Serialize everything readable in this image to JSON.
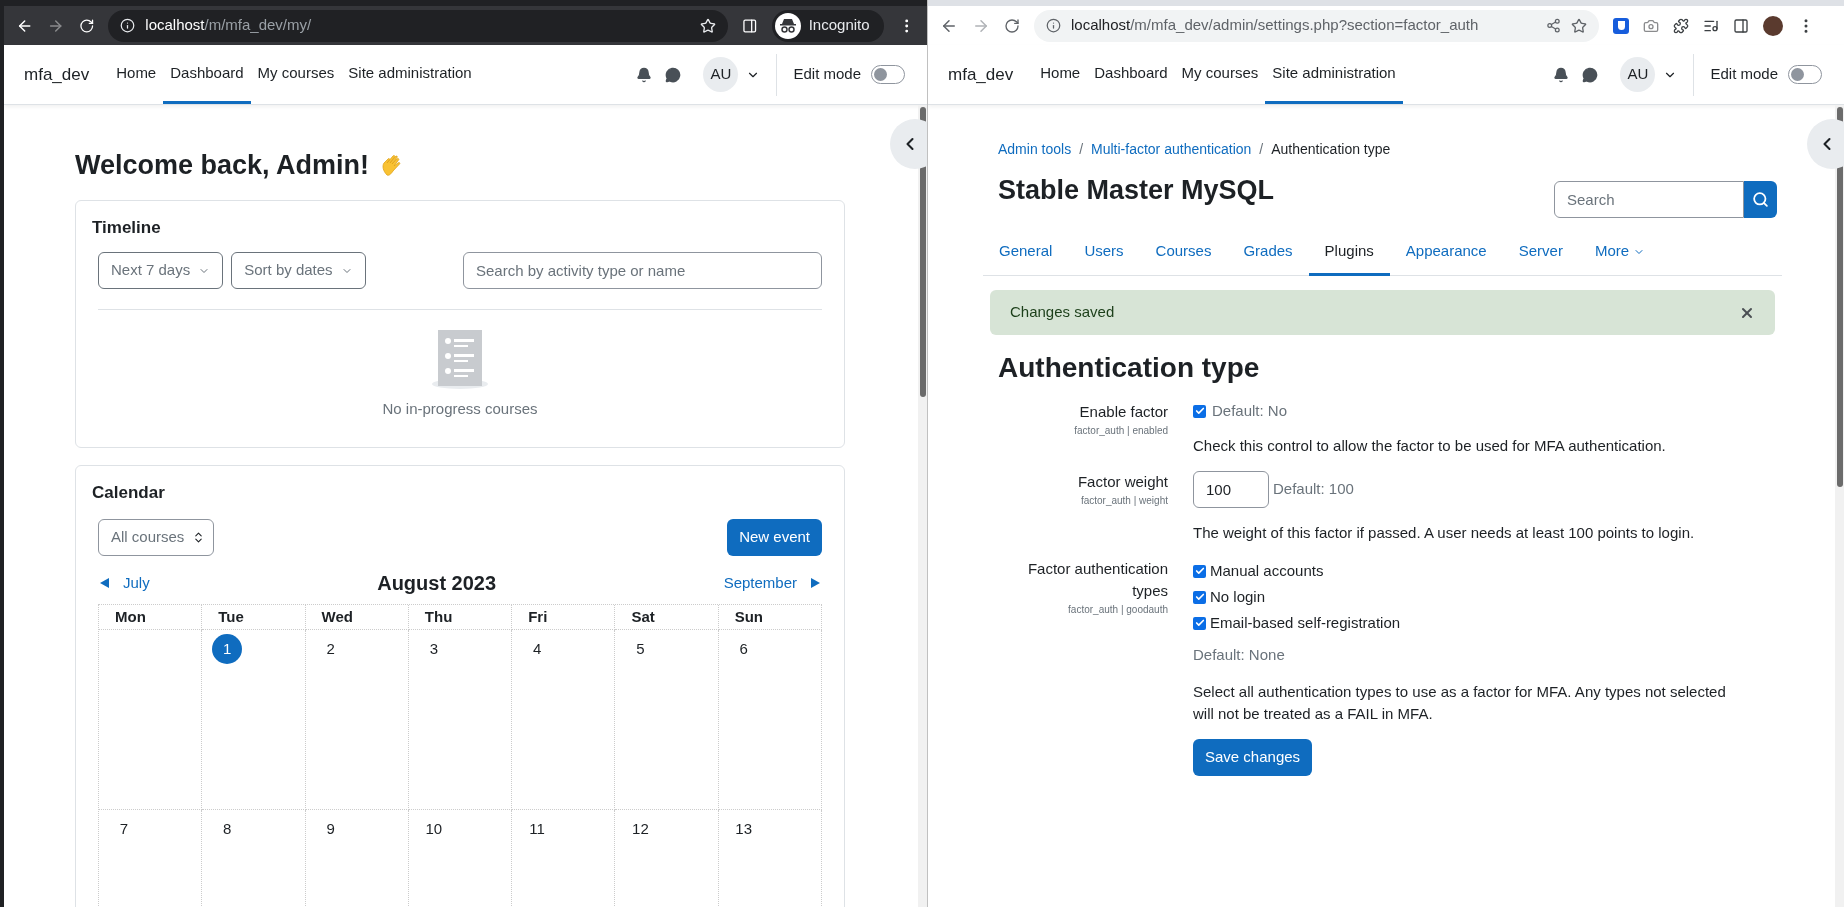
{
  "left_window": {
    "browser": {
      "url_host": "localhost",
      "url_path": "/m/mfa_dev/my/",
      "incognito_label": "Incognito"
    },
    "navbar": {
      "site_name": "mfa_dev",
      "items": [
        {
          "label": "Home",
          "selected": false
        },
        {
          "label": "Dashboard",
          "selected": true
        },
        {
          "label": "My courses",
          "selected": false
        },
        {
          "label": "Site administration",
          "selected": false
        }
      ],
      "avatar": "AU",
      "edit_mode": {
        "label": "Edit mode",
        "on": false
      }
    },
    "heading": "Welcome back, Admin!",
    "timeline": {
      "title": "Timeline",
      "filters": [
        "Next 7 days",
        "Sort by dates"
      ],
      "search": {
        "placeholder": "Search by activity type or name"
      },
      "empty_text": "No in-progress courses"
    },
    "calendar": {
      "title": "Calendar",
      "course_select": "All courses",
      "new_event": "New event",
      "prev_month": "July",
      "month": "August 2023",
      "next_month": "September",
      "weekdays": [
        "Mon",
        "Tue",
        "Wed",
        "Thu",
        "Fri",
        "Sat",
        "Sun"
      ],
      "weeks": [
        [
          {
            "today": false
          },
          {
            "day": "1",
            "today": true
          },
          {
            "day": "2",
            "today": false
          },
          {
            "day": "3",
            "today": false
          },
          {
            "day": "4",
            "today": false
          },
          {
            "day": "5",
            "today": false
          },
          {
            "day": "6",
            "today": false
          }
        ],
        [
          {
            "day": "7",
            "today": false
          },
          {
            "day": "8",
            "today": false
          },
          {
            "day": "9",
            "today": false
          },
          {
            "day": "10",
            "today": false
          },
          {
            "day": "11",
            "today": false
          },
          {
            "day": "12",
            "today": false
          },
          {
            "day": "13",
            "today": false
          }
        ]
      ]
    }
  },
  "right_window": {
    "browser": {
      "url_host": "localhost",
      "url_path": "/m/mfa_dev/admin/settings.php?section=factor_auth"
    },
    "navbar": {
      "site_name": "mfa_dev",
      "items": [
        {
          "label": "Home",
          "selected": false
        },
        {
          "label": "Dashboard",
          "selected": false
        },
        {
          "label": "My courses",
          "selected": false
        },
        {
          "label": "Site administration",
          "selected": true
        }
      ],
      "avatar": "AU",
      "edit_mode": {
        "label": "Edit mode",
        "on": false
      }
    },
    "breadcrumb": {
      "separator": "/",
      "items": [
        {
          "label": "Admin tools",
          "link": true
        },
        {
          "label": "Multi-factor authentication",
          "link": true
        },
        {
          "label": "Authentication type",
          "link": false
        }
      ]
    },
    "site_title": "Stable Master MySQL",
    "search": {
      "placeholder": "Search"
    },
    "tabs": [
      {
        "label": "General",
        "selected": false
      },
      {
        "label": "Users",
        "selected": false
      },
      {
        "label": "Courses",
        "selected": false
      },
      {
        "label": "Grades",
        "selected": false
      },
      {
        "label": "Plugins",
        "selected": true
      },
      {
        "label": "Appearance",
        "selected": false
      },
      {
        "label": "Server",
        "selected": false
      },
      {
        "label": "More",
        "selected": false
      }
    ],
    "alert": "Changes saved",
    "page_heading": "Authentication type",
    "settings": [
      {
        "kind": "checkbox",
        "label": "Enable factor",
        "setting_id": "factor_auth | enabled",
        "checked": true,
        "default": "Default: No",
        "description": "Check this control to allow the factor to be used for MFA authentication."
      },
      {
        "kind": "text",
        "label": "Factor weight",
        "setting_id": "factor_auth | weight",
        "value": "100",
        "default": "Default: 100",
        "description": "The weight of this factor if passed. A user needs at least 100 points to login."
      },
      {
        "kind": "multicheck",
        "label": "Factor authentication types",
        "setting_id": "factor_auth | goodauth",
        "options": [
          {
            "label": "Manual accounts",
            "checked": true
          },
          {
            "label": "No login",
            "checked": true
          },
          {
            "label": "Email-based self-registration",
            "checked": true
          }
        ],
        "default": "Default: None",
        "description": "Select all authentication types to use as a factor for MFA. Any types not selected will not be treated as a FAIL in MFA."
      }
    ],
    "save_button": "Save changes"
  }
}
